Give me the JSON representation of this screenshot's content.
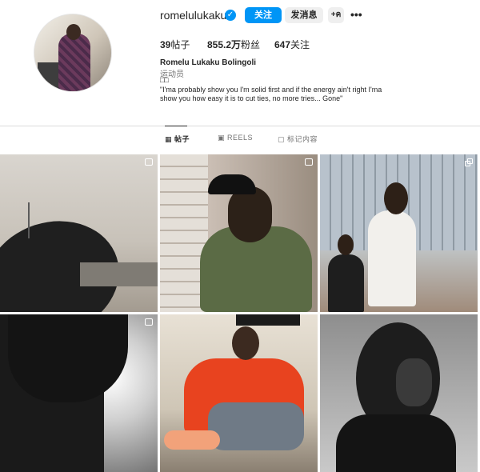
{
  "profile": {
    "username": "romelulukaku",
    "follow_label": "关注",
    "message_label": "发消息",
    "add_label": "+ค",
    "more_label": "•••",
    "stats": {
      "posts_num": "39",
      "posts_label": "帖子",
      "followers_num": "855.2万",
      "followers_label": "粉丝",
      "following_num": "647",
      "following_label": "关注"
    },
    "full_name": "Romelu Lukaku Bolingoli",
    "category": "运动员",
    "bio_line1": "□□",
    "bio_text": "\"I'ma probably show you I'm solid first and if the energy ain't right I'ma show you how easy it is to cut ties, no more tries... Gone\""
  },
  "tabs": [
    {
      "label": "帖子",
      "icon": "grid-icon",
      "active": true
    },
    {
      "label": "REELS",
      "icon": "reels-icon",
      "active": false
    },
    {
      "label": "标记内容",
      "icon": "tagged-icon",
      "active": false
    }
  ],
  "grid": [
    {
      "type": "reel"
    },
    {
      "type": "reel"
    },
    {
      "type": "carousel"
    },
    {
      "type": "reel"
    },
    {
      "type": "photo"
    },
    {
      "type": "photo"
    }
  ],
  "colors": {
    "accent": "#0095f6",
    "text": "#262626",
    "muted": "#737373",
    "divider": "#dbdbdb"
  }
}
